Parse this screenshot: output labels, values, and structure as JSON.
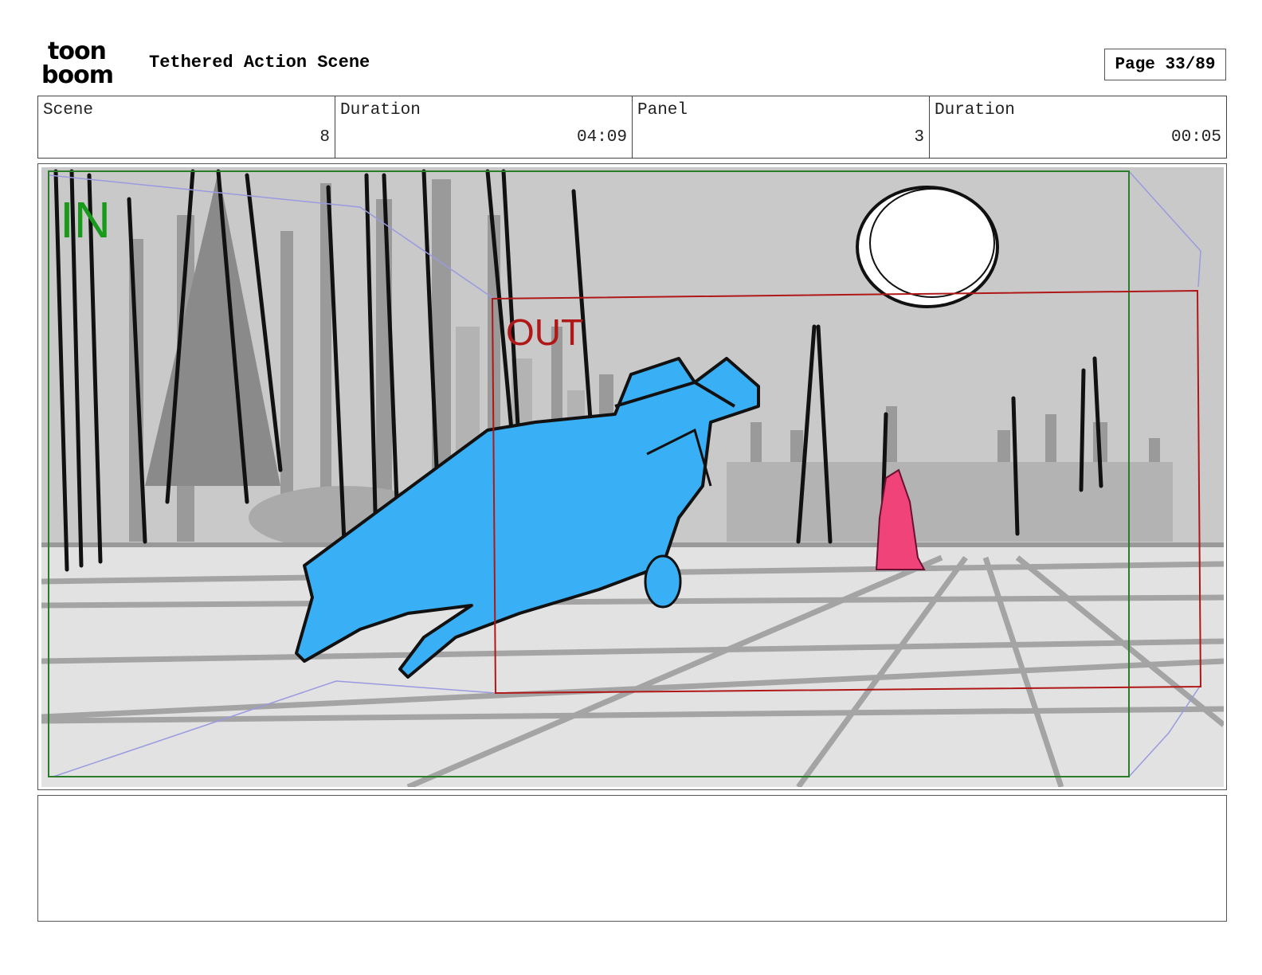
{
  "header": {
    "logo_line1": "toon",
    "logo_line2": "boom",
    "project_title": "Tethered Action Scene",
    "page_indicator": "Page 33/89"
  },
  "info": {
    "scene_label": "Scene",
    "scene_value": "8",
    "scene_duration_label": "Duration",
    "scene_duration_value": "04:09",
    "panel_label": "Panel",
    "panel_value": "3",
    "panel_duration_label": "Duration",
    "panel_duration_value": "00:05"
  },
  "panel": {
    "camera_in_label": "IN",
    "camera_out_label": "OUT",
    "colors": {
      "background": "#c8c8c8",
      "floor": "#e2e2e2",
      "camera_in": "#1a9a1a",
      "camera_out": "#b01818",
      "hero": "#39b0f5",
      "figure": "#f0437a",
      "motion_path": "#9a9ae0"
    }
  },
  "notes": {}
}
